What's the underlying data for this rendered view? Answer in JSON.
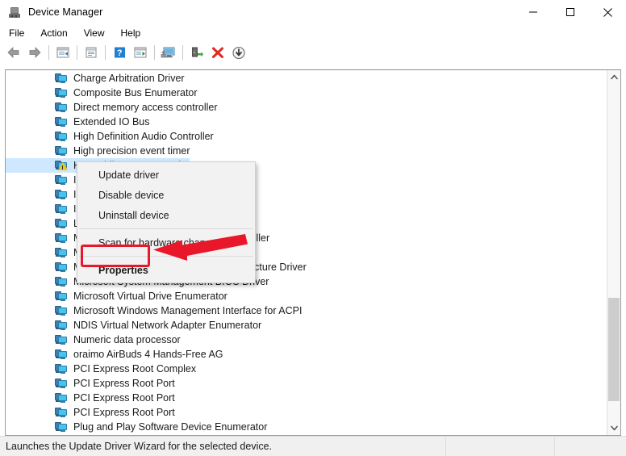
{
  "window": {
    "title": "Device Manager",
    "icon": "device-manager-icon",
    "controls": [
      {
        "name": "minimize-button",
        "glyph": "minimize"
      },
      {
        "name": "maximize-button",
        "glyph": "maximize"
      },
      {
        "name": "close-button",
        "glyph": "close"
      }
    ]
  },
  "menubar": {
    "items": [
      {
        "label": "File"
      },
      {
        "label": "Action"
      },
      {
        "label": "View"
      },
      {
        "label": "Help"
      }
    ]
  },
  "toolbar": {
    "buttons": [
      {
        "name": "back-icon",
        "title": "Back"
      },
      {
        "name": "forward-icon",
        "title": "Forward"
      },
      {
        "name": "show-hide-console-tree-icon",
        "title": "Show/Hide Console Tree"
      },
      {
        "name": "properties-icon",
        "title": "Properties"
      },
      {
        "name": "help-icon",
        "title": "Help"
      },
      {
        "name": "update-driver-icon",
        "title": "Update Driver Software"
      },
      {
        "name": "scan-for-hardware-changes-icon",
        "title": "Scan for hardware changes"
      },
      {
        "name": "enable-device-icon",
        "title": "Enable device"
      },
      {
        "name": "uninstall-device-icon",
        "title": "Uninstall device"
      },
      {
        "name": "disable-device-icon",
        "title": "Disable device"
      }
    ]
  },
  "device_list": {
    "rows": [
      {
        "label": "Charge Arbitration Driver",
        "icon": "device-icon",
        "selected": false,
        "warning": false
      },
      {
        "label": "Composite Bus Enumerator",
        "icon": "device-icon",
        "selected": false,
        "warning": false
      },
      {
        "label": "Direct memory access controller",
        "icon": "device-icon",
        "selected": false,
        "warning": false
      },
      {
        "label": "Extended IO Bus",
        "icon": "device-icon",
        "selected": false,
        "warning": false
      },
      {
        "label": "High Definition Audio Controller",
        "icon": "device-icon",
        "selected": false,
        "warning": false
      },
      {
        "label": "High precision event timer",
        "icon": "device-icon",
        "selected": false,
        "warning": false
      },
      {
        "label": "HP Mobile Data Protection Sensor",
        "icon": "device-icon-warning",
        "selected": true,
        "warning": true
      },
      {
        "label": "Intel(R) Management Engine",
        "icon": "device-icon",
        "selected": false,
        "warning": false
      },
      {
        "label": "Intel(R) Power Engine Plug-in",
        "icon": "device-icon",
        "selected": false,
        "warning": false
      },
      {
        "label": "Intel(R) Serial IO GPIO Host Controller",
        "icon": "device-icon",
        "selected": false,
        "warning": false
      },
      {
        "label": "Legacy device",
        "icon": "device-icon",
        "selected": false,
        "warning": false
      },
      {
        "label": "Microsoft ACPI-Compliant System controller",
        "icon": "device-icon",
        "selected": false,
        "warning": false
      },
      {
        "label": "Microsoft Basic Display Driver",
        "icon": "device-icon",
        "selected": false,
        "warning": false
      },
      {
        "label": "Microsoft Hyper-V Virtualization Infrastructure Driver",
        "icon": "device-icon",
        "selected": false,
        "warning": false
      },
      {
        "label": "Microsoft System Management BIOS Driver",
        "icon": "device-icon",
        "selected": false,
        "warning": false
      },
      {
        "label": "Microsoft Virtual Drive Enumerator",
        "icon": "device-icon",
        "selected": false,
        "warning": false
      },
      {
        "label": "Microsoft Windows Management Interface for ACPI",
        "icon": "device-icon",
        "selected": false,
        "warning": false
      },
      {
        "label": "NDIS Virtual Network Adapter Enumerator",
        "icon": "device-icon",
        "selected": false,
        "warning": false
      },
      {
        "label": "Numeric data processor",
        "icon": "device-icon",
        "selected": false,
        "warning": false
      },
      {
        "label": "oraimo AirBuds 4 Hands-Free AG",
        "icon": "device-icon",
        "selected": false,
        "warning": false
      },
      {
        "label": "PCI Express Root Complex",
        "icon": "device-icon",
        "selected": false,
        "warning": false
      },
      {
        "label": "PCI Express Root Port",
        "icon": "device-icon",
        "selected": false,
        "warning": false
      },
      {
        "label": "PCI Express Root Port",
        "icon": "device-icon",
        "selected": false,
        "warning": false
      },
      {
        "label": "PCI Express Root Port",
        "icon": "device-icon",
        "selected": false,
        "warning": false
      },
      {
        "label": "Plug and Play Software Device Enumerator",
        "icon": "device-icon",
        "selected": false,
        "warning": false
      }
    ]
  },
  "context_menu": {
    "items": [
      {
        "label": "Update driver",
        "bold": false,
        "separator_after": false
      },
      {
        "label": "Disable device",
        "bold": false,
        "separator_after": false
      },
      {
        "label": "Uninstall device",
        "bold": false,
        "separator_after": true
      },
      {
        "label": "Scan for hardware changes",
        "bold": false,
        "separator_after": true
      },
      {
        "label": "Properties",
        "bold": true,
        "separator_after": false
      }
    ]
  },
  "annotations": {
    "highlight_color": "#e8172a",
    "highlight_target": "Properties",
    "arrow": "pointer-arrow-left"
  },
  "statusbar": {
    "message": "Launches the Update Driver Wizard for the selected device.",
    "pane2": "",
    "pane3": ""
  },
  "scrollbar": {
    "up_arrow": "chevron-up-icon",
    "down_arrow": "chevron-down-icon"
  }
}
